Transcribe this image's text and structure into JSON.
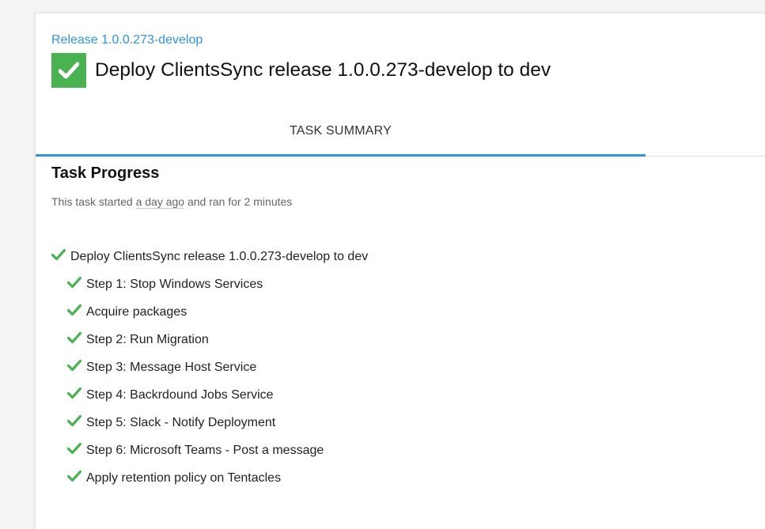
{
  "release_link": "Release 1.0.0.273-develop",
  "page_title": "Deploy ClientsSync release 1.0.0.273-develop to dev",
  "tabs": [
    {
      "label": "TASK SUMMARY",
      "active": true
    }
  ],
  "progress": {
    "heading": "Task Progress",
    "started_prefix": "This task started",
    "started_relative": "a day ago",
    "started_suffix": "and ran for 2 minutes"
  },
  "colors": {
    "accent": "#2f93e0",
    "success": "#48b350"
  },
  "tasks": [
    {
      "label": "Deploy ClientsSync release 1.0.0.273-develop to dev",
      "status": "success",
      "icon": "check-icon",
      "level": 0
    },
    {
      "label": "Step 1: Stop Windows Services",
      "status": "success",
      "icon": "check-icon",
      "level": 1
    },
    {
      "label": "Acquire packages",
      "status": "success",
      "icon": "check-icon",
      "level": 1
    },
    {
      "label": "Step 2: Run Migration",
      "status": "success",
      "icon": "check-icon",
      "level": 1
    },
    {
      "label": "Step 3: Message Host Service",
      "status": "success",
      "icon": "check-icon",
      "level": 1
    },
    {
      "label": "Step 4: Backrdound Jobs Service",
      "status": "success",
      "icon": "check-icon",
      "level": 1
    },
    {
      "label": "Step 5: Slack - Notify Deployment",
      "status": "success",
      "icon": "check-icon",
      "level": 1
    },
    {
      "label": "Step 6: Microsoft Teams - Post a message",
      "status": "success",
      "icon": "check-icon",
      "level": 1
    },
    {
      "label": "Apply retention policy on Tentacles",
      "status": "success",
      "icon": "check-icon",
      "level": 1
    }
  ]
}
